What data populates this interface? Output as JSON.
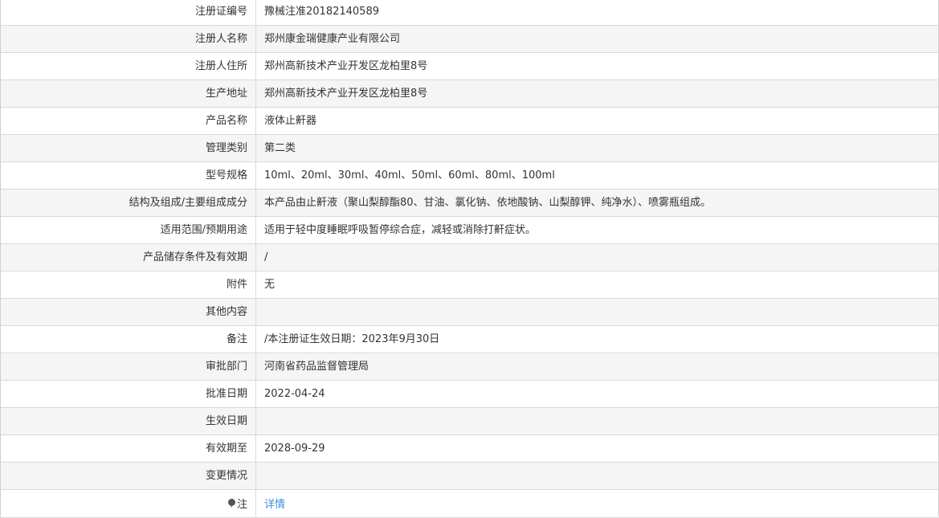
{
  "rows": [
    {
      "label": "注册证编号",
      "value": "豫械注准20182140589"
    },
    {
      "label": "注册人名称",
      "value": "郑州康金瑞健康产业有限公司"
    },
    {
      "label": "注册人住所",
      "value": "郑州高新技术产业开发区龙柏里8号"
    },
    {
      "label": "生产地址",
      "value": "郑州高新技术产业开发区龙柏里8号"
    },
    {
      "label": "产品名称",
      "value": "液体止鼾器"
    },
    {
      "label": "管理类别",
      "value": "第二类"
    },
    {
      "label": "型号规格",
      "value": "10ml、20ml、30ml、40ml、50ml、60ml、80ml、100ml"
    },
    {
      "label": "结构及组成/主要组成成分",
      "value": "本产品由止鼾液（聚山梨醇酯80、甘油、氯化钠、依地酸钠、山梨醇钾、纯净水）、喷雾瓶组成。"
    },
    {
      "label": "适用范围/预期用途",
      "value": "适用于轻中度睡眠呼吸暂停综合症，减轻或消除打鼾症状。"
    },
    {
      "label": "产品储存条件及有效期",
      "value": "/"
    },
    {
      "label": "附件",
      "value": "无"
    },
    {
      "label": "其他内容",
      "value": ""
    },
    {
      "label": "备注",
      "value": "/本注册证生效日期：2023年9月30日"
    },
    {
      "label": "审批部门",
      "value": "河南省药品监督管理局"
    },
    {
      "label": "批准日期",
      "value": "2022-04-24"
    },
    {
      "label": "生效日期",
      "value": ""
    },
    {
      "label": "有效期至",
      "value": "2028-09-29"
    },
    {
      "label": "变更情况",
      "value": ""
    }
  ],
  "note": {
    "icon": "pin-icon",
    "label": "注",
    "link_text": "详情"
  },
  "colors": {
    "border": "#d9d9d9",
    "alt_row_background": "#f5f5f5",
    "text": "#333333",
    "link": "#3a8fd9"
  }
}
